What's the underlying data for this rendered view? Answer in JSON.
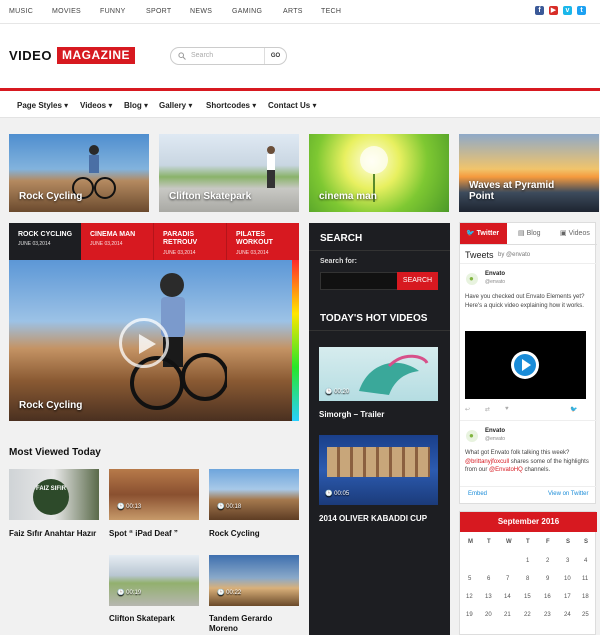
{
  "topnav": {
    "categories": [
      "MUSIC",
      "MOVIES",
      "FUNNY",
      "SPORT",
      "NEWS",
      "GAMING",
      "ARTS",
      "TECH"
    ],
    "social": [
      "facebook-icon",
      "youtube-icon",
      "vimeo-icon",
      "twitter-icon"
    ]
  },
  "header": {
    "logo_part1": "VIDEO",
    "logo_part2": "MAGAZINE",
    "search_placeholder": "Search",
    "search_button": "GO"
  },
  "menu": [
    "Page Styles",
    "Videos",
    "Blog",
    "Gallery",
    "Shortcodes",
    "Contact Us"
  ],
  "featured": [
    "Rock Cycling",
    "Clifton Skatepark",
    "cinema man",
    "Waves at Pyramid Point"
  ],
  "slider": {
    "tabs": [
      {
        "title": "ROCK CYCLING",
        "date": "JUNE 03,2014"
      },
      {
        "title": "CINEMA MAN",
        "date": "JUNE 03,2014"
      },
      {
        "title": "PARADIS RETROUV",
        "date": "JUNE 03,2014"
      },
      {
        "title": "PILATES WORKOUT",
        "date": "JUNE 03,2014"
      }
    ],
    "caption": "Rock Cycling"
  },
  "most_viewed": {
    "heading": "Most Viewed Today",
    "items": [
      {
        "title": "Faiz Sıfır Anahtar Hazır",
        "time": ""
      },
      {
        "title": "Spot “ iPad Deaf ”",
        "time": "00:13"
      },
      {
        "title": "Rock Cycling",
        "time": "00:18"
      },
      {
        "title": "Clifton Skatepark",
        "time": "00:19"
      },
      {
        "title": "Tandem Gerardo Moreno",
        "time": "00:22"
      }
    ]
  },
  "sidebar": {
    "search_heading": "SEARCH",
    "search_label": "Search for:",
    "search_button": "SEARCH",
    "hot_heading": "TODAY'S HOT VIDEOS",
    "hot": [
      {
        "title": "Simorgh – Trailer",
        "time": "00:20"
      },
      {
        "title": "2014 OLIVER KABADDI CUP",
        "time": "00:05"
      }
    ]
  },
  "widget": {
    "tabs": [
      "Twitter",
      "Blog",
      "Videos"
    ],
    "tweets_heading": "Tweets",
    "tweets_by": "@envato",
    "tweet1": {
      "name": "Envato",
      "handle": "@envato",
      "text": "Have you checked out Envato Elements yet? Here's a quick video explaining how it works."
    },
    "tweet2": {
      "name": "Envato",
      "handle": "@envato",
      "text_pre": "What got Envato folk talking this week? ",
      "mention1": "@brittanyjfoxcull",
      "text_mid": " shares some of the highlights from our ",
      "mention2": "@EnvatoHQ",
      "text_post": " channels."
    },
    "embed_label": "Embed",
    "view_label": "View on Twitter"
  },
  "calendar": {
    "month": "September 2016",
    "days": [
      "M",
      "T",
      "W",
      "T",
      "F",
      "S",
      "S"
    ],
    "dates": [
      "",
      "",
      "",
      "1",
      "2",
      "3",
      "4",
      "5",
      "6",
      "7",
      "8",
      "9",
      "10",
      "11",
      "12",
      "13",
      "14",
      "15",
      "16",
      "17",
      "18",
      "19",
      "20",
      "21",
      "22",
      "23",
      "24",
      "25"
    ]
  },
  "colors": {
    "accent": "#d71920",
    "dark": "#1d1e22"
  }
}
